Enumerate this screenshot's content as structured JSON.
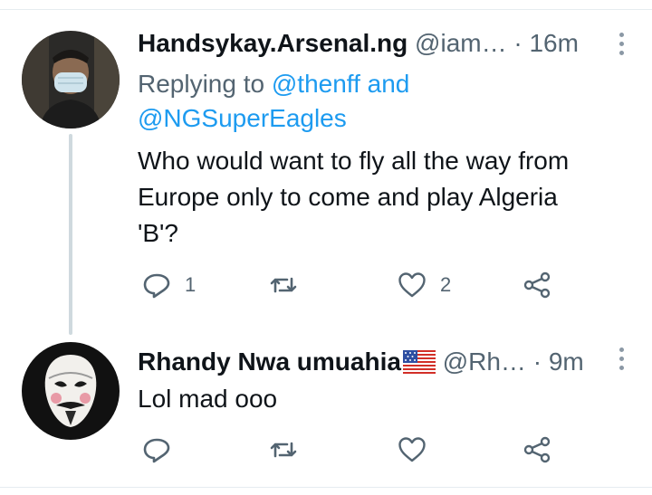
{
  "tweets": [
    {
      "display_name": "Handsykay.Arsenal.ng",
      "handle": "@iam…",
      "separator": "·",
      "time": "16m",
      "replying_prefix": "Replying to",
      "mention_1": "@thenff",
      "mention_join": "and",
      "mention_2": "@NGSuperEagles",
      "text_line_1": "Who would want to fly all the way from",
      "text_line_2": "Europe only to come and play Algeria",
      "text_line_3": "'B'?",
      "reply_count": "1",
      "retweet_count": "",
      "like_count": "2"
    },
    {
      "display_name": "Rhandy Nwa umuahia",
      "handle": "@Rh…",
      "separator": "·",
      "time": "9m",
      "text_line_1": "Lol mad ooo",
      "reply_count": "",
      "retweet_count": "",
      "like_count": ""
    }
  ],
  "icons": {
    "reply": "reply-icon",
    "retweet": "retweet-icon",
    "like": "heart-icon",
    "share": "share-icon",
    "more": "more-vertical-icon",
    "flag": "us-flag-icon"
  },
  "colors": {
    "link": "#1d9bf0",
    "secondary_text": "#536471",
    "primary_text": "#0f1419",
    "thread_line": "#cfd9de"
  }
}
